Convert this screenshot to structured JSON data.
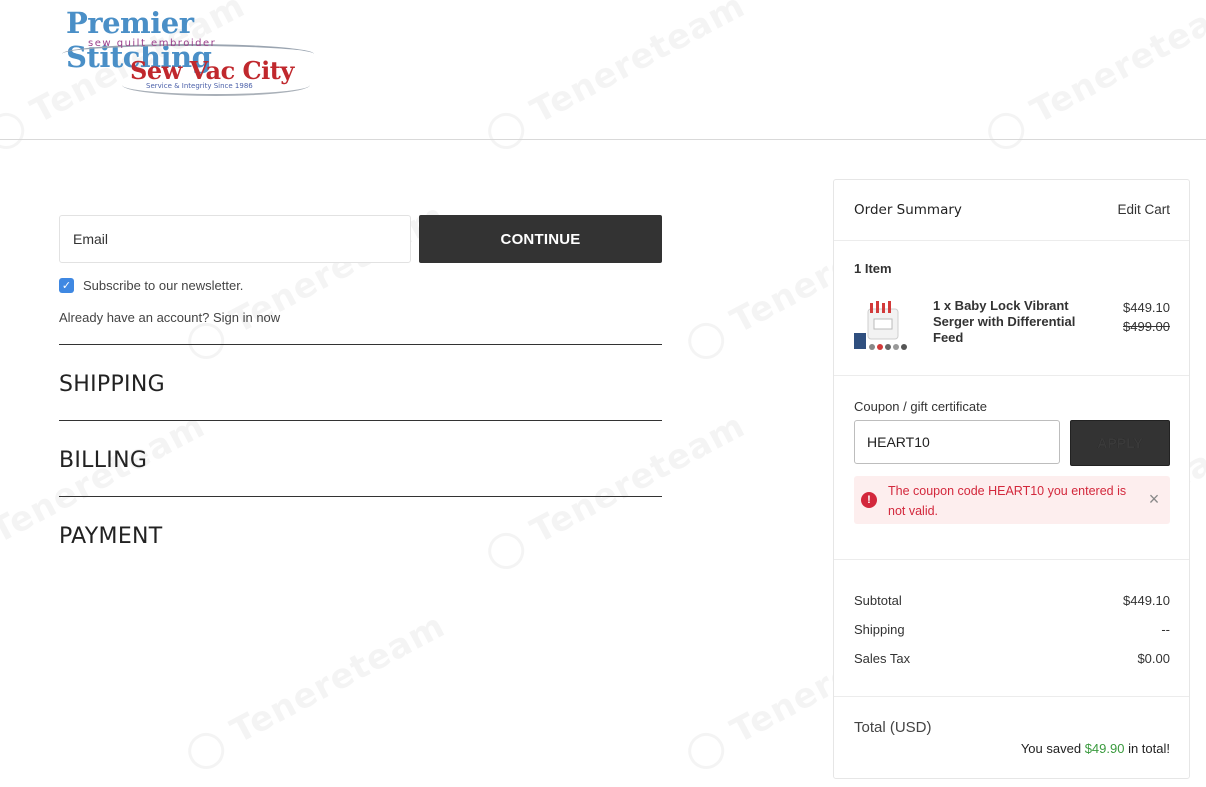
{
  "header": {
    "logo_line1": "Premier Stitching",
    "logo_tagline": "sew quilt embroider",
    "logo_line2": "Sew Vac City",
    "logo_sub": "Service & Integrity Since 1986"
  },
  "watermark_text": "Tenereteam",
  "customer": {
    "email_label": "Email",
    "continue_label": "CONTINUE",
    "newsletter_label": "Subscribe to our newsletter.",
    "newsletter_checked": true,
    "account_prompt": "Already have an account?",
    "sign_in_label": "Sign in now"
  },
  "sections": [
    {
      "title": "SHIPPING"
    },
    {
      "title": "BILLING"
    },
    {
      "title": "PAYMENT"
    }
  ],
  "summary": {
    "title": "Order Summary",
    "edit_cart": "Edit Cart",
    "items_count": "1 Item",
    "product": {
      "name": "1 x Baby Lock Vibrant Serger with Differential Feed",
      "price": "$449.10",
      "original_price": "$499.00"
    },
    "coupon_label": "Coupon / gift certificate",
    "coupon_value": "HEART10",
    "apply_label": "APPLY",
    "error_message": "The coupon code HEART10 you entered is not valid.",
    "totals": [
      {
        "label": "Subtotal",
        "value": "$449.10"
      },
      {
        "label": "Shipping",
        "value": "--"
      },
      {
        "label": "Sales Tax",
        "value": "$0.00"
      }
    ],
    "total_label": "Total (USD)",
    "saved_prefix": "You saved",
    "saved_amount": "$49.90",
    "saved_suffix": "in total!"
  },
  "colors": {
    "button_dark": "#333333",
    "checkbox_blue": "#3f88e2",
    "error_red": "#d3283c",
    "error_bg": "#fdeeee",
    "savings_green": "#3a9a3e"
  }
}
